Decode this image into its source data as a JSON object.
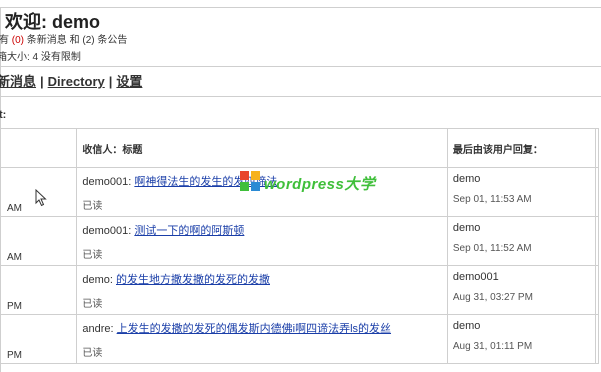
{
  "header": {
    "welcome": "欢迎: demo",
    "msg_prefix": "有",
    "new_msg_count": "(0)",
    "msg_middle": "条新消息 和",
    "notice_count": "(2)",
    "msg_suffix": "条公告",
    "quota": "箱大小: 4 没有限制"
  },
  "nav": {
    "items": [
      {
        "label": "新消息"
      },
      {
        "label": "Directory"
      },
      {
        "label": "设置"
      }
    ],
    "separator": "|"
  },
  "section": {
    "label": "t:"
  },
  "table": {
    "headers": [
      "",
      "收信人：标题",
      "最后由该用户回复：",
      ""
    ],
    "rows": [
      {
        "time_tail": "AM",
        "recipient": "demo001:",
        "subject": "啊神得法生的发生的发四谛法",
        "status": "已读",
        "last_user": "demo",
        "last_time": "Sep 01, 11:53 AM"
      },
      {
        "time_tail": "AM",
        "recipient": "demo001:",
        "subject": "测试一下的啊的阿斯顿",
        "status": "已读",
        "last_user": "demo",
        "last_time": "Sep 01, 11:52 AM"
      },
      {
        "time_tail": "PM",
        "recipient": "demo:",
        "subject": "的发生地方撒发撒的发死的发撒",
        "status": "已读",
        "last_user": "demo001",
        "last_time": "Aug 31, 03:27 PM"
      },
      {
        "time_tail": "PM",
        "recipient": "andre:",
        "subject": "上发生的发撒的发死的偶发斯内德佛i啊四谛法弄ls的发丝",
        "status": "已读",
        "last_user": "demo",
        "last_time": "Aug 31, 01:11 PM"
      }
    ]
  },
  "watermark": {
    "text": "wordpress大学",
    "color": "#3fbf3a",
    "logo_colors": [
      "#e8452c",
      "#f6b21b",
      "#3fbf3a",
      "#2a8ad4"
    ]
  }
}
